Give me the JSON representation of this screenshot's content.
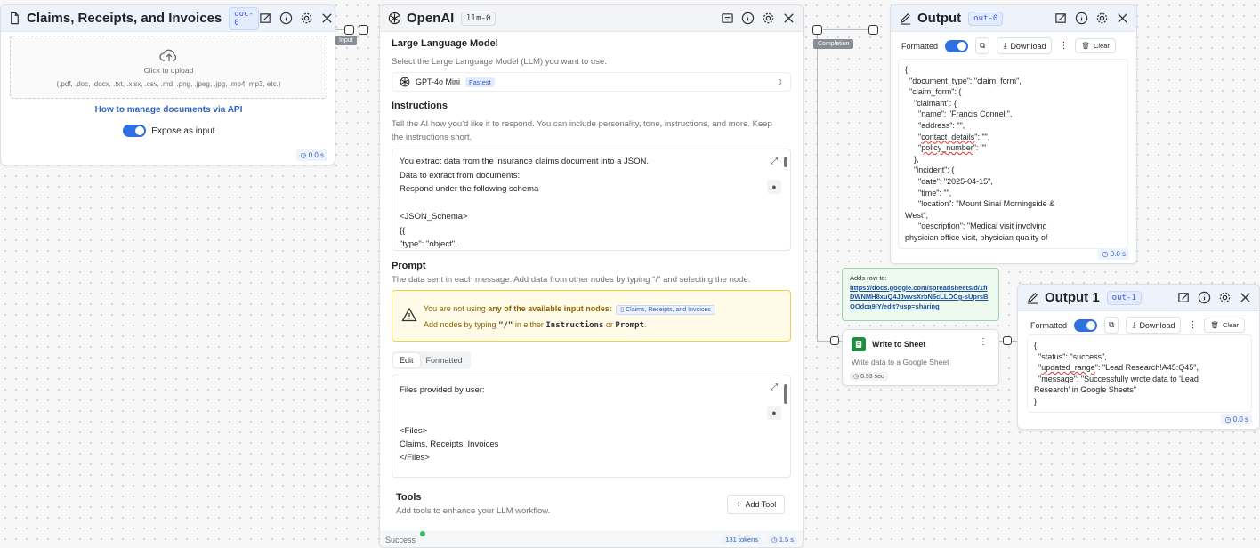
{
  "doc_node": {
    "title": "Claims, Receipts, and Invoices",
    "tag": "doc-0",
    "upload_label": "Click to upload",
    "upload_types": "(.pdf, .doc, .docx, .txt, .xlsx, .csv, .md, .png, .jpeg, .jpg, .mp4, mp3, etc.)",
    "api_link": "How to manage documents via API",
    "expose_label": "Expose as input",
    "time": "0.0 s",
    "port_label": "Input"
  },
  "llm_node": {
    "title": "OpenAI",
    "tag": "llm-0",
    "model_section": "Large Language Model",
    "model_desc": "Select the Large Language Model (LLM) you want to use.",
    "model_name": "GPT-4o Mini",
    "model_badge": "Fastest",
    "instructions_title": "Instructions",
    "instructions_desc": "Tell the AI how you'd like it to respond. You can include personality, tone, instructions, and more. Keep the instructions short.",
    "instructions_text": "You extract data from the insurance claims document into a JSON.\nData to extract from documents:\nRespond under the following schema\n\n<JSON_Schema>\n{{\n\"type\": \"object\",",
    "prompt_title": "Prompt",
    "prompt_desc": "The data sent in each message. Add data from other nodes by typing \"/\" and selecting the node.",
    "warning_prefix": "You are not using ",
    "warning_bold": "any of the available input nodes:",
    "warning_chip": "Claims, Receipts, and Invoices",
    "warning_line2_a": "Add nodes by typing ",
    "warning_slash": "\"/\"",
    "warning_line2_b": " in either ",
    "warning_instr": "Instructions",
    "warning_or": " or ",
    "warning_prompt": "Prompt",
    "warning_end": ".",
    "tab_edit": "Edit",
    "tab_formatted": "Formatted",
    "prompt_text": "Files provided by user:\n\n\n<Files>\nClaims, Receipts, Invoices\n</Files>",
    "tools_title": "Tools",
    "tools_desc": "Add tools to enhance your LLM workflow.",
    "add_tool": "Add Tool",
    "status": "Success",
    "tokens": "131 tokens",
    "time": "1.5 s",
    "port_label": "Completion"
  },
  "output_node": {
    "title": "Output",
    "tag": "out-0",
    "formatted": "Formatted",
    "download": "Download",
    "clear": "Clear",
    "time": "0.0 s",
    "json_before": "{\n  \"document_type\": \"claim_form\",\n  \"claim_form\": {\n    \"claimant\": {\n      \"name\": \"Francis Connell\",\n      \"address\": \"\",\n      \"",
    "json_contact": "contact_details",
    "json_mid": "\": \"\",\n      \"",
    "json_policy": "policy_number",
    "json_after": "\": \"\"\n    },\n    \"incident\": {\n      \"date\": \"2025-04-15\",\n      \"time\": \"\",\n      \"location\": \"Mount Sinai Morningside &\nWest\",\n      \"description\": \"Medical visit involving\nphysician office visit, physician quality of"
  },
  "sheet_note": {
    "label": "Adds row to:",
    "url": "https://docs.google.com/spreadsheets/d/1fIDWNMH8xuQ4JJwvsXrbN6cLLOCg-sUprsBOOdca9lY/edit?usp=sharing"
  },
  "sheet_node": {
    "title": "Write to Sheet",
    "desc": "Write data to a Google Sheet",
    "time": "0.93 sec"
  },
  "output1_node": {
    "title": "Output 1",
    "tag": "out-1",
    "formatted": "Formatted",
    "download": "Download",
    "clear": "Clear",
    "time": "0.0 s",
    "json_a": "{\n  \"status\": \"success\",\n  \"",
    "json_ur": "updated_range",
    "json_b": "\": \"Lead Research!A45:Q45\",\n  \"message\": \"Successfully wrote data to 'Lead\nResearch' in Google Sheets\"\n}"
  }
}
